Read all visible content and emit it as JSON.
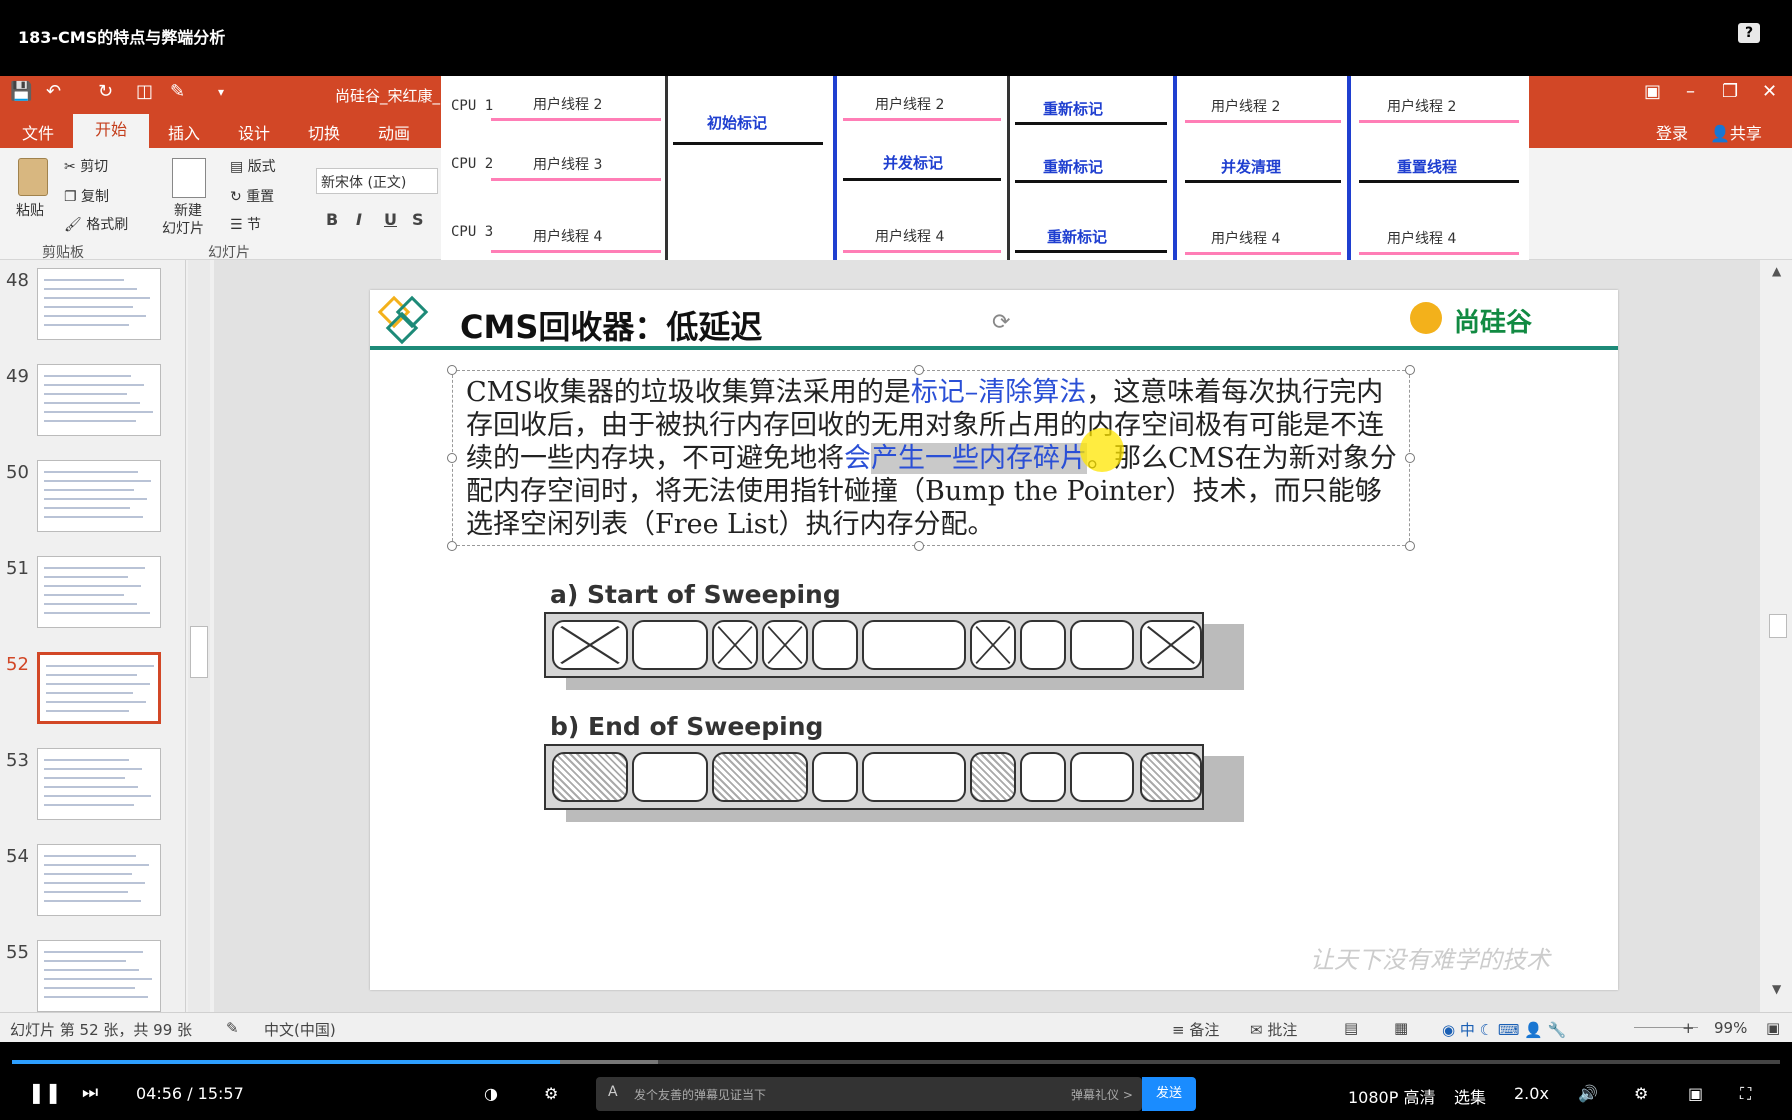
{
  "video": {
    "title": "183-CMS的特点与弊端分析",
    "help": "?"
  },
  "ppt": {
    "doc_title": "尚硅谷_宋红康_",
    "tabs": [
      "文件",
      "开始",
      "插入",
      "设计",
      "切换",
      "动画"
    ],
    "login": "登录",
    "share": "共享",
    "ribbon": {
      "paste": "粘贴",
      "cut": "剪切",
      "copy": "复制",
      "format_painter": "格式刷",
      "clipboard_group": "剪贴板",
      "new_slide_1": "新建",
      "new_slide_2": "幻灯片",
      "layout": "版式",
      "reset": "重置",
      "section": "节",
      "slides_group": "幻灯片",
      "font": "新宋体 (正文)",
      "bold": "B",
      "italic": "I",
      "underline": "U",
      "strike": "S"
    }
  },
  "cpu_diagram": {
    "cpus": [
      "CPU 1",
      "CPU 2",
      "CPU 3"
    ],
    "columns": [
      {
        "rows": [
          "用户线程 2",
          "用户线程 3",
          "用户线程 4"
        ]
      },
      {
        "single": "初始标记"
      },
      {
        "rows": [
          "用户线程 2",
          "并发标记",
          "用户线程 4"
        ]
      },
      {
        "rows": [
          "重新标记",
          "重新标记",
          "重新标记"
        ]
      },
      {
        "rows": [
          "用户线程 2",
          "并发清理",
          "用户线程 4"
        ]
      },
      {
        "rows": [
          "用户线程 2",
          "重置线程",
          "用户线程 4"
        ]
      }
    ]
  },
  "thumbnails": {
    "numbers": [
      "48",
      "49",
      "50",
      "51",
      "52",
      "53",
      "54",
      "55"
    ],
    "selected": "52"
  },
  "slide": {
    "title": "CMS回收器：低延迟",
    "logo": "尚硅谷",
    "body_parts": [
      {
        "t": "CMS收集器的垃圾收集算法采用的是",
        "c": ""
      },
      {
        "t": "标记–清除算法",
        "c": "blue"
      },
      {
        "t": "，这意味着每次执行完内存回收后，由于被执行内存回收的无用对象所占用的内存空间极有可能是不连续的一些内存块，不可避免地将",
        "c": ""
      },
      {
        "t": "会",
        "c": "blue"
      },
      {
        "t": "产生一些内存碎片",
        "c": "blue hl"
      },
      {
        "t": "。那么CMS在为新对象分配内存空间时，将无法使用指针碰撞（Bump the Pointer）技术，而只能够选择空闲列表（Free List）执行内存分配。",
        "c": ""
      }
    ],
    "fig_a": "a) Start of Sweeping",
    "fig_b": "b) End of Sweeping",
    "watermark": "让天下没有难学的技术"
  },
  "status": {
    "slide_info": "幻灯片 第 52 张，共 99 张",
    "language": "中文(中国)",
    "notes": "备注",
    "comments": "批注",
    "zoom": "99%"
  },
  "player": {
    "time": "04:56 / 15:57",
    "progress": 0.31,
    "danmaku_placeholder": "发个友善的弹幕见证当下",
    "danmaku_etiquette": "弹幕礼仪 >",
    "send": "发送",
    "quality": "1080P 高清",
    "episodes": "选集",
    "speed": "2.0x"
  },
  "colors": {
    "accent": "#d24726",
    "teal": "#1d8a78",
    "blue_text": "#2a4fd6",
    "arrow_pink": "#ff7eb6",
    "progress": "#2d9fff"
  }
}
